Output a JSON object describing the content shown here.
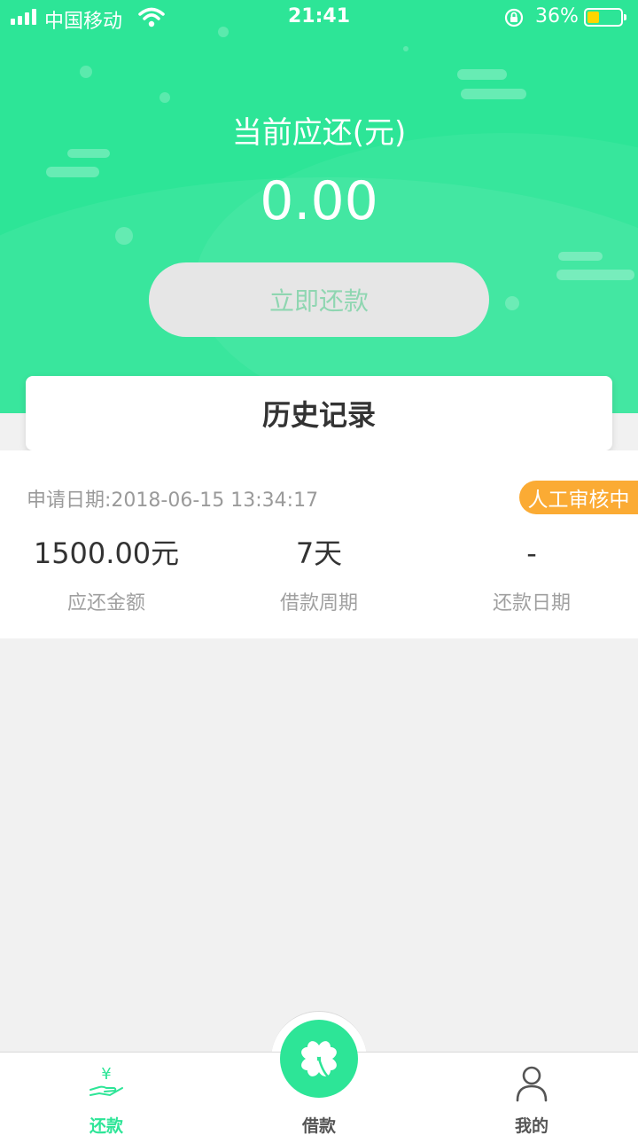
{
  "status_bar": {
    "carrier": "中国移动",
    "time": "21:41",
    "battery_percent": "36%",
    "battery_level": 0.36
  },
  "hero": {
    "title": "当前应还(元)",
    "amount": "0.00",
    "repay_button": "立即还款"
  },
  "history": {
    "title": "历史记录"
  },
  "record": {
    "apply_date": "申请日期:2018-06-15 13:34:17",
    "status": "人工审核中",
    "columns": [
      {
        "value": "1500.00元",
        "label": "应还金额"
      },
      {
        "value": "7天",
        "label": "借款周期"
      },
      {
        "value": "-",
        "label": "还款日期"
      }
    ]
  },
  "tabbar": {
    "tabs": [
      {
        "label": "还款",
        "icon": "repay-icon",
        "active": true
      },
      {
        "label": "借款",
        "icon": "clover-icon",
        "active": false
      },
      {
        "label": "我的",
        "icon": "profile-icon",
        "active": false
      }
    ]
  },
  "colors": {
    "brand_green": "#2de597",
    "badge_orange": "#fbab34",
    "battery_yellow": "#ffd600"
  }
}
